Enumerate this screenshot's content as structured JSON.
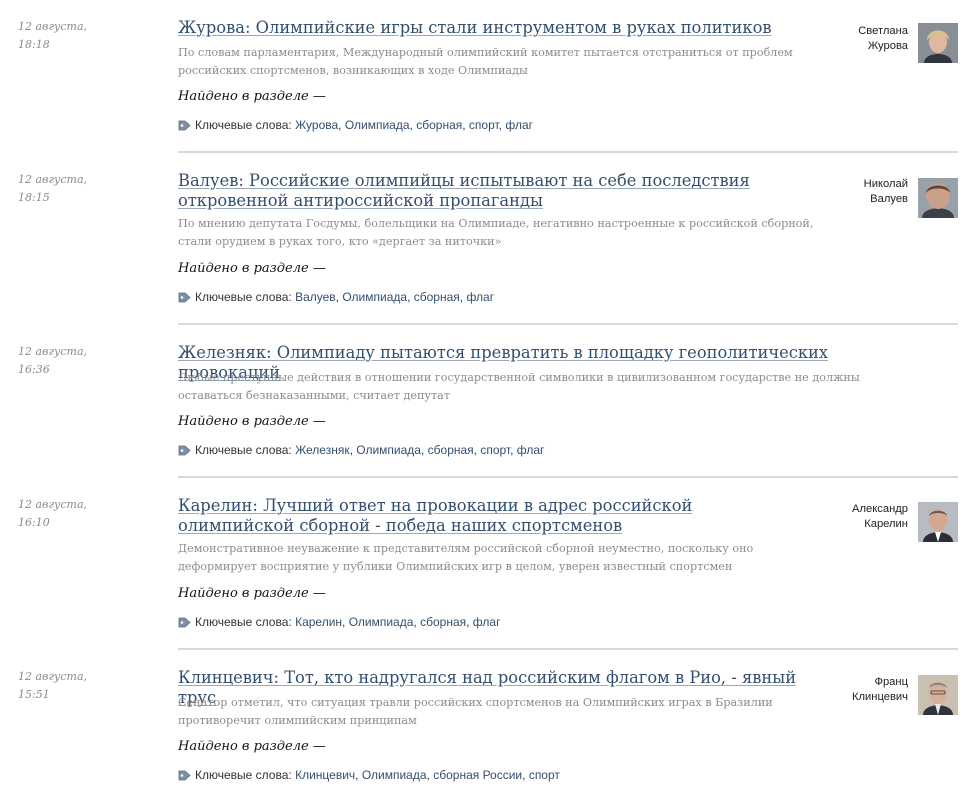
{
  "labels": {
    "found_in_section": "Найдено в разделе",
    "dash": "—",
    "keywords_label": "Ключевые слова:"
  },
  "items": [
    {
      "date": "12 августа,",
      "time": "18:18",
      "title": "Журова: Олимпийские игры стали инструментом в руках политиков",
      "lead": "По словам парламентария, Международный олимпийский комитет пытается отстраниться от проблем российских спортсменов, возникающих в ходе Олимпиады",
      "keywords": [
        "Журова",
        "Олимпиада",
        "сборная",
        "спорт",
        "флаг"
      ],
      "author_first": "Светлана",
      "author_last": "Журова"
    },
    {
      "date": "12 августа,",
      "time": "18:15",
      "title": "Валуев: Российские олимпийцы испытывают на себе последствия откровенной антироссийской пропаганды",
      "lead": "По мнению депутата Госдумы, болельщики на Олимпиаде, негативно настроенные к российской сборной, стали орудием в руках того, кто «дергает за ниточки»",
      "keywords": [
        "Валуев",
        "Олимпиада",
        "сборная",
        "флаг"
      ],
      "author_first": "Николай",
      "author_last": "Валуев"
    },
    {
      "date": "12 августа,",
      "time": "16:36",
      "title": "Железняк: Олимпиаду пытаются превратить в площадку геополитических провокаций",
      "lead": "Любые преступные действия в отношении государственной символики в цивилизованном государстве не должны оставаться безнаказанными, считает депутат",
      "keywords": [
        "Железняк",
        "Олимпиада",
        "сборная",
        "спорт",
        "флаг"
      ],
      "author_first": "",
      "author_last": ""
    },
    {
      "date": "12 августа,",
      "time": "16:10",
      "title": "Карелин: Лучший ответ на провокации в адрес российской олимпийской сборной - победа наших спортсменов",
      "lead": "Демонстративное неуважение к представителям российской сборной неуместно, поскольку оно деформирует восприятие у публики Олимпийских игр в целом, уверен известный спортсмен",
      "keywords": [
        "Карелин",
        "Олимпиада",
        "сборная",
        "флаг"
      ],
      "author_first": "Александр",
      "author_last": "Карелин"
    },
    {
      "date": "12 августа,",
      "time": "15:51",
      "title": "Клинцевич: Тот, кто надругался над российским флагом в Рио, - явный трус",
      "lead": "Сенатор отметил, что ситуация травли российских спортсменов на Олимпийских играх в Бразилии противоречит олимпийским принципам",
      "keywords": [
        "Клинцевич",
        "Олимпиада",
        "сборная России",
        "спорт"
      ],
      "author_first": "Франц",
      "author_last": "Клинцевич"
    }
  ]
}
